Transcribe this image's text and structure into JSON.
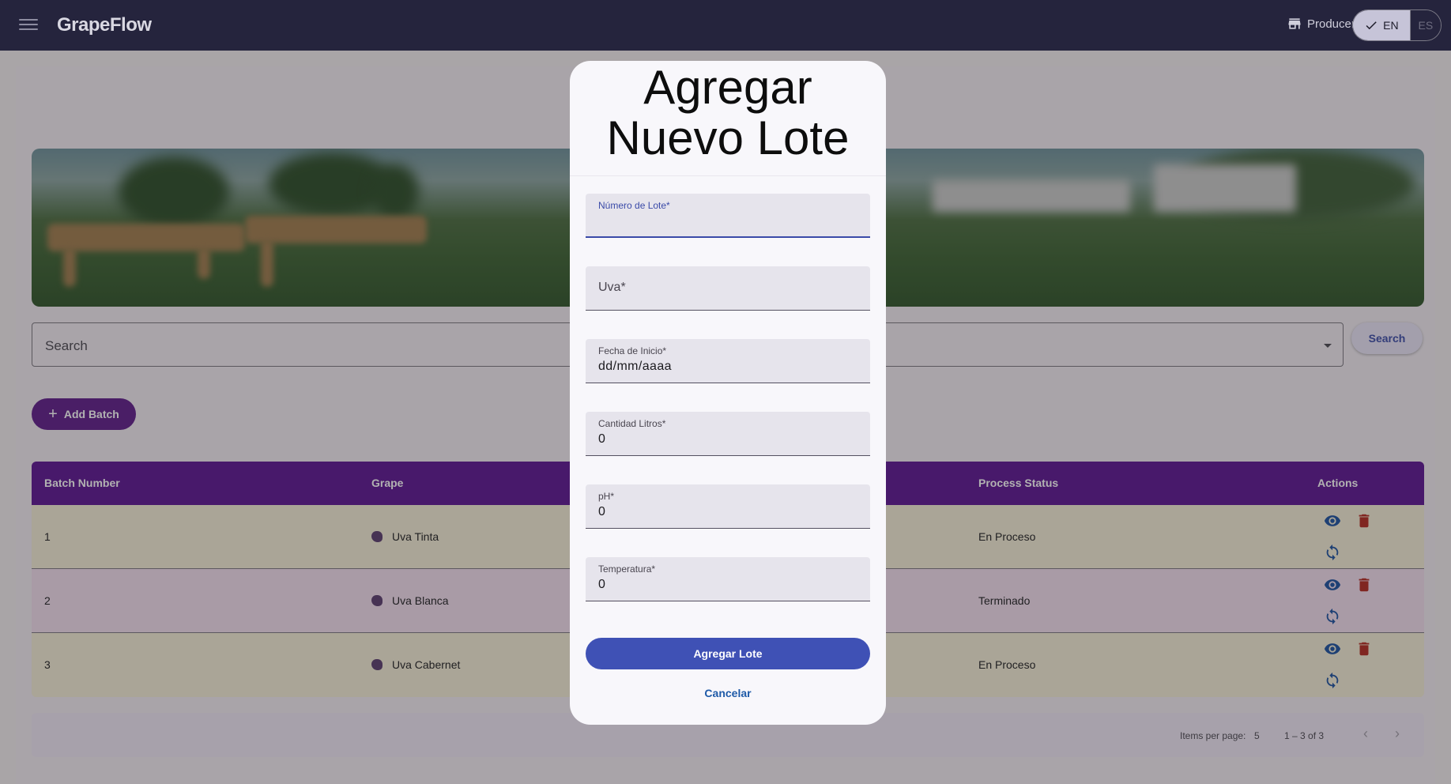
{
  "app": {
    "brand": "GrapeFlow",
    "role": "Producer"
  },
  "lang": {
    "en": "EN",
    "es": "ES"
  },
  "search": {
    "placeholder": "Search",
    "button": "Search"
  },
  "add_batch_label": "Add Batch",
  "table": {
    "headers": {
      "batch_number": "Batch Number",
      "grape": "Grape",
      "process_status": "Process Status",
      "actions": "Actions"
    },
    "rows": [
      {
        "batch": "1",
        "grape": "Uva Tinta",
        "status": "En Proceso"
      },
      {
        "batch": "2",
        "grape": "Uva Blanca",
        "status": "Terminado"
      },
      {
        "batch": "3",
        "grape": "Uva Cabernet",
        "status": "En Proceso"
      }
    ]
  },
  "paginator": {
    "items_label": "Items per page:",
    "page_size": "5",
    "range": "1 – 3 of 3"
  },
  "dialog": {
    "title": "Agregar Nuevo Lote",
    "fields": {
      "numero": {
        "label": "Número de Lote*",
        "value": ""
      },
      "uva": {
        "label": "Uva*"
      },
      "fecha": {
        "label": "Fecha de Inicio*",
        "value": "dd/mm/aaaa"
      },
      "litros": {
        "label": "Cantidad Litros*",
        "value": "0"
      },
      "ph": {
        "label": "pH*",
        "value": "0"
      },
      "temperatura": {
        "label": "Temperatura*",
        "value": "0"
      }
    },
    "submit": "Agregar Lote",
    "cancel": "Cancelar"
  },
  "colors": {
    "topbar": "#25243d",
    "header": "#5c1292",
    "primary": "#3f51b5",
    "view_icon": "#1a4fa0",
    "delete_icon": "#b3261e"
  }
}
